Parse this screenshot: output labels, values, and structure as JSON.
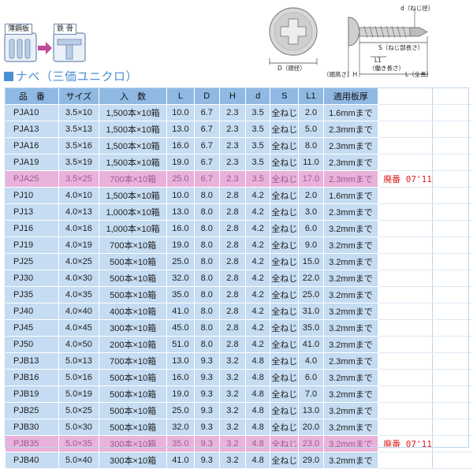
{
  "diagram": {
    "thin_plate_label": "薄鋼板",
    "steel_frame_label": "鉄 骨"
  },
  "screw_figure": {
    "d_label": "d（ねじ径）",
    "d_head_label": "D（頭径）",
    "h_label": "（頭高さ）H",
    "s_label": "S（ねじ部長さ）",
    "l1_label": "L1",
    "l1_sub_label": "（働き長さ）",
    "l_label": "L（全長）"
  },
  "section_title": "ナベ（三価ユニクロ）",
  "table": {
    "headers": [
      "品　番",
      "サイズ",
      "入　数",
      "L",
      "D",
      "H",
      "d",
      "S",
      "L1",
      "適用板厚"
    ],
    "rows": [
      {
        "cells": [
          "PJA10",
          "3.5×10",
          "1,500本×10箱",
          "10.0",
          "6.7",
          "2.3",
          "3.5",
          "全ねじ",
          "2.0",
          "1.6mmまで"
        ],
        "note": "",
        "discontinued": false
      },
      {
        "cells": [
          "PJA13",
          "3.5×13",
          "1,500本×10箱",
          "13.0",
          "6.7",
          "2.3",
          "3.5",
          "全ねじ",
          "5.0",
          "2.3mmまで"
        ],
        "note": "",
        "discontinued": false
      },
      {
        "cells": [
          "PJA16",
          "3.5×16",
          "1,500本×10箱",
          "16.0",
          "6.7",
          "2.3",
          "3.5",
          "全ねじ",
          "8.0",
          "2.3mmまで"
        ],
        "note": "",
        "discontinued": false
      },
      {
        "cells": [
          "PJA19",
          "3.5×19",
          "1,500本×10箱",
          "19.0",
          "6.7",
          "2.3",
          "3.5",
          "全ねじ",
          "11.0",
          "2.3mmまで"
        ],
        "note": "",
        "discontinued": false
      },
      {
        "cells": [
          "PJA25",
          "3.5×25",
          "700本×10箱",
          "25.0",
          "6.7",
          "2.3",
          "3.5",
          "全ねじ",
          "17.0",
          "2.3mmまで"
        ],
        "note": "廃番 07'11",
        "discontinued": true
      },
      {
        "cells": [
          "PJ10",
          "4.0×10",
          "1,500本×10箱",
          "10.0",
          "8.0",
          "2.8",
          "4.2",
          "全ねじ",
          "2.0",
          "1.6mmまで"
        ],
        "note": "",
        "discontinued": false
      },
      {
        "cells": [
          "PJ13",
          "4.0×13",
          "1,000本×10箱",
          "13.0",
          "8.0",
          "2.8",
          "4.2",
          "全ねじ",
          "3.0",
          "2.3mmまで"
        ],
        "note": "",
        "discontinued": false
      },
      {
        "cells": [
          "PJ16",
          "4.0×16",
          "1,000本×10箱",
          "16.0",
          "8.0",
          "2.8",
          "4.2",
          "全ねじ",
          "6.0",
          "3.2mmまで"
        ],
        "note": "",
        "discontinued": false
      },
      {
        "cells": [
          "PJ19",
          "4.0×19",
          "700本×10箱",
          "19.0",
          "8.0",
          "2.8",
          "4.2",
          "全ねじ",
          "9.0",
          "3.2mmまで"
        ],
        "note": "",
        "discontinued": false
      },
      {
        "cells": [
          "PJ25",
          "4.0×25",
          "500本×10箱",
          "25.0",
          "8.0",
          "2.8",
          "4.2",
          "全ねじ",
          "15.0",
          "3.2mmまで"
        ],
        "note": "",
        "discontinued": false
      },
      {
        "cells": [
          "PJ30",
          "4.0×30",
          "500本×10箱",
          "32.0",
          "8.0",
          "2.8",
          "4.2",
          "全ねじ",
          "22.0",
          "3.2mmまで"
        ],
        "note": "",
        "discontinued": false
      },
      {
        "cells": [
          "PJ35",
          "4.0×35",
          "500本×10箱",
          "35.0",
          "8.0",
          "2.8",
          "4.2",
          "全ねじ",
          "25.0",
          "3.2mmまで"
        ],
        "note": "",
        "discontinued": false
      },
      {
        "cells": [
          "PJ40",
          "4.0×40",
          "400本×10箱",
          "41.0",
          "8.0",
          "2.8",
          "4.2",
          "全ねじ",
          "31.0",
          "3.2mmまで"
        ],
        "note": "",
        "discontinued": false
      },
      {
        "cells": [
          "PJ45",
          "4.0×45",
          "300本×10箱",
          "45.0",
          "8.0",
          "2.8",
          "4.2",
          "全ねじ",
          "35.0",
          "3.2mmまで"
        ],
        "note": "",
        "discontinued": false
      },
      {
        "cells": [
          "PJ50",
          "4.0×50",
          "200本×10箱",
          "51.0",
          "8.0",
          "2.8",
          "4.2",
          "全ねじ",
          "41.0",
          "3.2mmまで"
        ],
        "note": "",
        "discontinued": false
      },
      {
        "cells": [
          "PJB13",
          "5.0×13",
          "700本×10箱",
          "13.0",
          "9.3",
          "3.2",
          "4.8",
          "全ねじ",
          "4.0",
          "2.3mmまで"
        ],
        "note": "",
        "discontinued": false
      },
      {
        "cells": [
          "PJB16",
          "5.0×16",
          "500本×10箱",
          "16.0",
          "9.3",
          "3.2",
          "4.8",
          "全ねじ",
          "6.0",
          "3.2mmまで"
        ],
        "note": "",
        "discontinued": false
      },
      {
        "cells": [
          "PJB19",
          "5.0×19",
          "500本×10箱",
          "19.0",
          "9.3",
          "3.2",
          "4.8",
          "全ねじ",
          "7.0",
          "3.2mmまで"
        ],
        "note": "",
        "discontinued": false
      },
      {
        "cells": [
          "PJB25",
          "5.0×25",
          "500本×10箱",
          "25.0",
          "9.3",
          "3.2",
          "4.8",
          "全ねじ",
          "13.0",
          "3.2mmまで"
        ],
        "note": "",
        "discontinued": false
      },
      {
        "cells": [
          "PJB30",
          "5.0×30",
          "500本×10箱",
          "32.0",
          "9.3",
          "3.2",
          "4.8",
          "全ねじ",
          "20.0",
          "3.2mmまで"
        ],
        "note": "",
        "discontinued": false
      },
      {
        "cells": [
          "PJB35",
          "5.0×35",
          "300本×10箱",
          "35.0",
          "9.3",
          "3.2",
          "4.8",
          "全ねじ",
          "23.0",
          "3.2mmまで"
        ],
        "note": "廃番 07'11",
        "discontinued": true
      },
      {
        "cells": [
          "PJB40",
          "5.0×40",
          "300本×10箱",
          "41.0",
          "9.3",
          "3.2",
          "4.8",
          "全ねじ",
          "29.0",
          "3.2mmまで"
        ],
        "note": "",
        "discontinued": false
      }
    ]
  },
  "colors": {
    "accent": "#4b8fd6",
    "header_bg": "#8fb9e3",
    "cell_bg": "#c5dcf2",
    "discontinued_bg": "#e9b2da",
    "note_text": "#e02020"
  }
}
